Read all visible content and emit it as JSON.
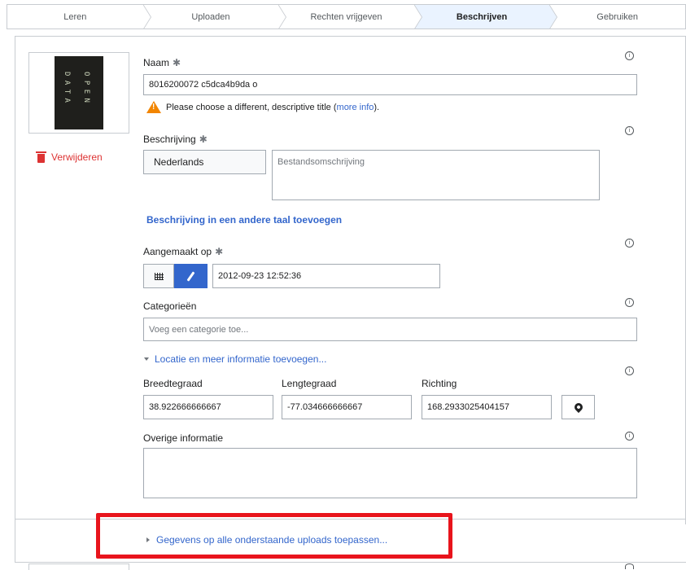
{
  "steps": [
    "Leren",
    "Uploaden",
    "Rechten vrijgeven",
    "Beschrijven",
    "Gebruiken"
  ],
  "thumbnail": {
    "text": [
      "O P E N",
      "D A T A"
    ]
  },
  "delete_label": "Verwijderen",
  "name": {
    "label": "Naam",
    "value": "8016200072 c5dca4b9da o",
    "warning_text": "Please choose a different, descriptive title (",
    "more_info": "more info",
    "warning_end": ")."
  },
  "description": {
    "label": "Beschrijving",
    "language": "Nederlands",
    "placeholder": "Bestandsomschrijving",
    "add_language": "Beschrijving in een andere taal toevoegen"
  },
  "created": {
    "label": "Aangemaakt op",
    "value": "2012-09-23 12:52:36"
  },
  "categories": {
    "label": "Categorieën",
    "placeholder": "Voeg een categorie toe..."
  },
  "location_toggle": "Locatie en meer informatie toevoegen...",
  "location": {
    "lat_label": "Breedtegraad",
    "lat": "38.922666666667",
    "lon_label": "Lengtegraad",
    "lon": "-77.034666666667",
    "dir_label": "Richting",
    "dir": "168.2933025404157"
  },
  "other_info": {
    "label": "Overige informatie"
  },
  "apply_all": "Gegevens op alle onderstaande uploads toepassen...",
  "required_mark": "✱",
  "info_mark": "i",
  "colors": {
    "accent": "#3366cc",
    "danger": "#d33333",
    "warning": "#f28500",
    "highlight": "#e8141c"
  }
}
